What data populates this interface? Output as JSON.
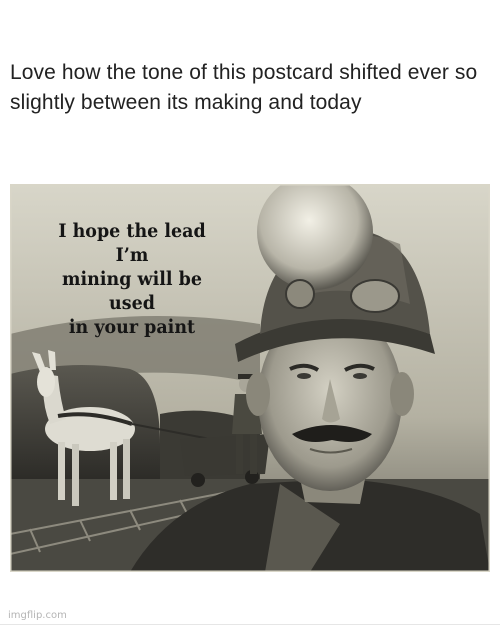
{
  "post": {
    "caption": "Love how the tone of this postcard shifted ever so slightly between its making and today"
  },
  "postcard": {
    "text_line_1": "I hope the lead I’m",
    "text_line_2": "mining will be used",
    "text_line_3": "in your paint"
  },
  "watermark": "imgflip.com",
  "colors": {
    "background": "#ffffff",
    "text": "#222222",
    "photo_dark": "#2c2b27",
    "photo_light": "#b9b7ab"
  }
}
